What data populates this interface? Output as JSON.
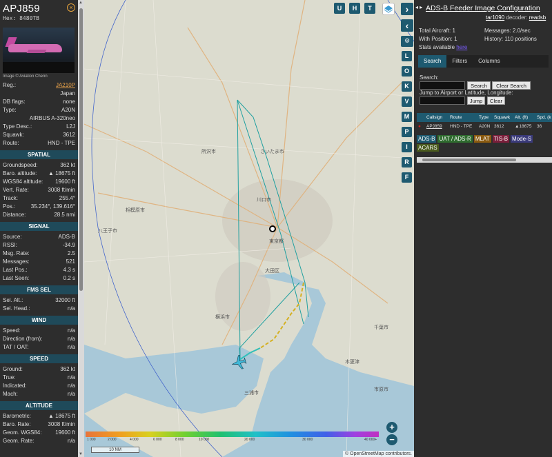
{
  "sidebar": {
    "callsign": "APJ859",
    "hex": "Hex: 8480TB",
    "photo_credit": "Image © Aviation Chenn",
    "info": [
      {
        "label": "Reg.:",
        "value": "JA210P",
        "link": true
      },
      {
        "label": "",
        "value": "Japan"
      },
      {
        "label": "DB flags:",
        "value": "none"
      },
      {
        "label": "Type:",
        "value": "A20N"
      },
      {
        "label": "",
        "value": "AIRBUS A-320neo"
      },
      {
        "label": "Type Desc.:",
        "value": "L2J"
      },
      {
        "label": "Squawk:",
        "value": "3612"
      },
      {
        "label": "Route:",
        "value": "HND - TPE"
      }
    ],
    "spatial_title": "SPATIAL",
    "spatial": [
      {
        "label": "Groundspeed:",
        "value": "362 kt"
      },
      {
        "label": "Baro. altitude:",
        "value": "▲ 18675 ft"
      },
      {
        "label": "WGS84 altitude:",
        "value": "19600 ft"
      },
      {
        "label": "Vert. Rate:",
        "value": "3008 ft/min"
      },
      {
        "label": "Track:",
        "value": "255.4°"
      },
      {
        "label": "Pos.:",
        "value": "35.234°, 139.616°"
      },
      {
        "label": "Distance:",
        "value": "28.5 nmi"
      }
    ],
    "signal_title": "SIGNAL",
    "signal": [
      {
        "label": "Source:",
        "value": "ADS-B"
      },
      {
        "label": "RSSI:",
        "value": "-34.9"
      },
      {
        "label": "Msg. Rate:",
        "value": "2.5"
      },
      {
        "label": "Messages:",
        "value": "521"
      },
      {
        "label": "Last Pos.:",
        "value": "4.3 s"
      },
      {
        "label": "Last Seen:",
        "value": "0.2 s"
      }
    ],
    "fms_title": "FMS SEL",
    "fms": [
      {
        "label": "Sel. Alt.:",
        "value": "32000 ft"
      },
      {
        "label": "Sel. Head.:",
        "value": "n/a"
      }
    ],
    "wind_title": "WIND",
    "wind": [
      {
        "label": "Speed:",
        "value": "n/a"
      },
      {
        "label": "Direction (from):",
        "value": "n/a"
      },
      {
        "label": "TAT / OAT:",
        "value": "n/a"
      }
    ],
    "speed_title": "SPEED",
    "speed": [
      {
        "label": "Ground:",
        "value": "362 kt"
      },
      {
        "label": "True:",
        "value": "n/a"
      },
      {
        "label": "Indicated:",
        "value": "n/a"
      },
      {
        "label": "Mach:",
        "value": "n/a"
      }
    ],
    "altitude_title": "ALTITUDE",
    "altitude": [
      {
        "label": "Barometric:",
        "value": "▲ 18675 ft"
      },
      {
        "label": "Baro. Rate:",
        "value": "3008 ft/min"
      },
      {
        "label": "Geom. WGS84:",
        "value": "19600 ft"
      },
      {
        "label": "Geom. Rate:",
        "value": "n/a"
      }
    ]
  },
  "map": {
    "buttons_top": [
      "U",
      "H",
      "T"
    ],
    "buttons_side": [
      "L",
      "O",
      "K",
      "V",
      "M",
      "P",
      "I",
      "R",
      "F"
    ],
    "colorbar_labels": [
      "1 000",
      "2 000",
      "4 000",
      "6 000",
      "8 000",
      "10 000",
      "20 000",
      "30 000",
      "40 000+"
    ],
    "scale_label": "10 NM",
    "attribution": "© OpenStreetMap contributors.",
    "place_labels": [
      "川口市",
      "東京都",
      "大田区",
      "横浜市",
      "千葉市",
      "市原市",
      "木更津",
      "三浦市",
      "相模原市",
      "八王子市",
      "所沢市",
      "さいたま市"
    ]
  },
  "right_panel": {
    "title": "ADS-B Feeder Image Configuration",
    "arrows": "◂ ▸",
    "receiver": "tar1090",
    "decoder_label": "decoder:",
    "decoder": "readsb",
    "total_aircraft": "Total Aircraft: 1",
    "with_position": "With Position: 1",
    "stats_available": "Stats available",
    "stats_link": "here",
    "messages": "Messages: 2.0/sec",
    "history": "History: 110 positions",
    "tabs": [
      "Search",
      "Filters",
      "Columns"
    ],
    "search_label": "Search:",
    "search_button": "Search",
    "clear_search_button": "Clear Search",
    "jump_label": "Jump to Airport or Latitude, Longitude:",
    "jump_button": "Jump",
    "clear_button": "Clear",
    "table_headers": [
      "",
      "Callsign",
      "Route",
      "Type",
      "Squawk",
      "Alt. (ft)",
      "Spd. (k"
    ],
    "table_row": [
      "●",
      "APJ859",
      "HND - TPE",
      "A20N",
      "3612",
      "▲18675",
      "36"
    ],
    "source_tags": [
      "ADS-B",
      "UAT / ADS-R",
      "MLAT",
      "TIS-B",
      "Mode-S",
      "ACARS"
    ]
  }
}
